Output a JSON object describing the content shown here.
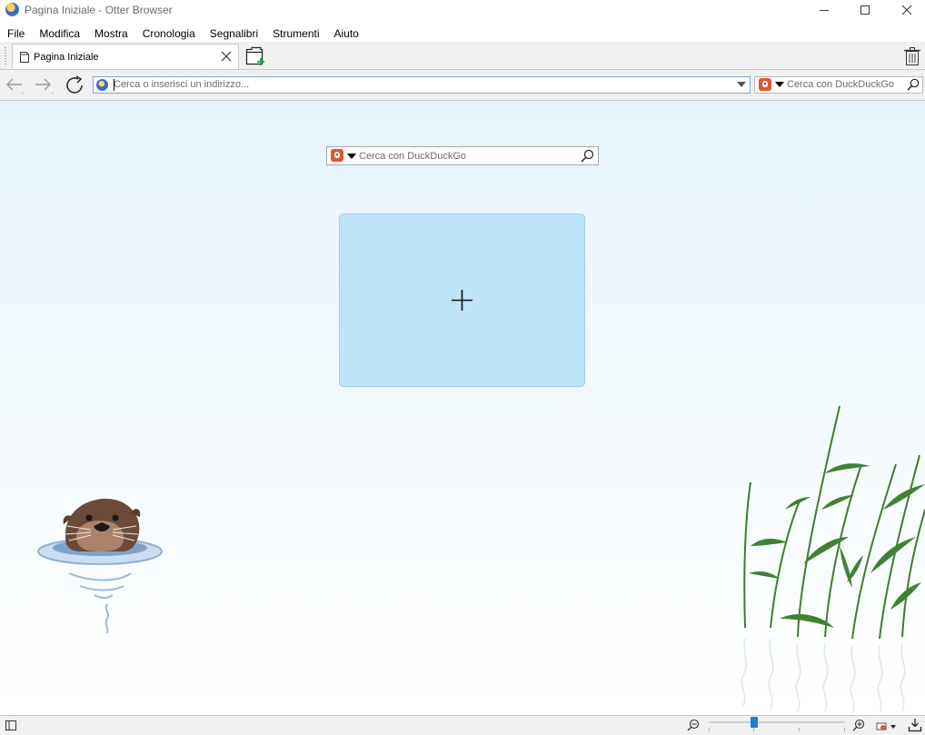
{
  "window": {
    "title": "Pagina Iniziale - Otter Browser"
  },
  "menu": [
    "File",
    "Modifica",
    "Mostra",
    "Cronologia",
    "Segnalibri",
    "Strumenti",
    "Aiuto"
  ],
  "tab": {
    "label": "Pagina Iniziale"
  },
  "address": {
    "placeholder": "Cerca o inserisci un indirizzo..."
  },
  "search": {
    "engine": "DuckDuckGo",
    "placeholder": "Cerca con DuckDuckGo"
  },
  "start_page": {
    "search_placeholder": "Cerca con DuckDuckGo",
    "add_tile_icon": "plus-icon"
  },
  "colors": {
    "accent": "#1e7fd8",
    "tile": "#bde4f7",
    "background_top": "#e5f3fb"
  },
  "icons": [
    "app-icon",
    "minimize-icon",
    "maximize-icon",
    "close-icon",
    "page-icon",
    "new-tab-icon",
    "trash-icon",
    "back-icon",
    "forward-icon",
    "reload-icon",
    "search-icon",
    "zoom-out-icon",
    "zoom-in-icon",
    "panel-icon",
    "download-icon"
  ]
}
